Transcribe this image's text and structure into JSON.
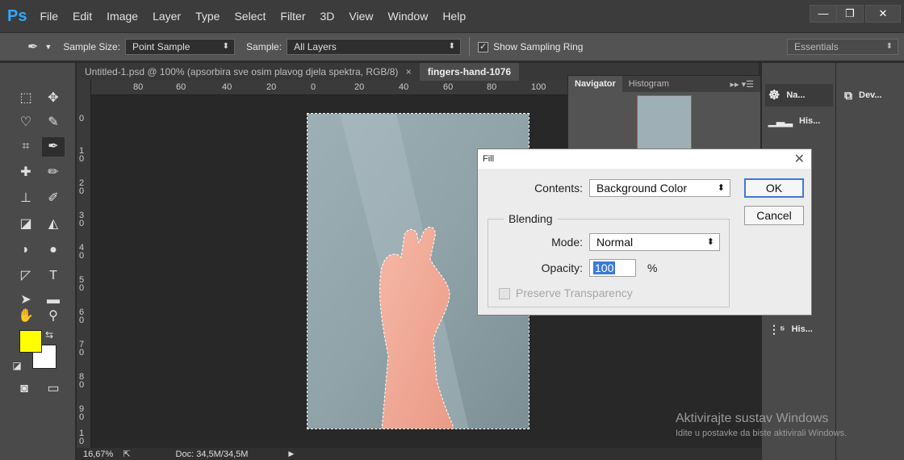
{
  "menubar": {
    "logo": "Ps",
    "items": [
      "File",
      "Edit",
      "Image",
      "Layer",
      "Type",
      "Select",
      "Filter",
      "3D",
      "View",
      "Window",
      "Help"
    ]
  },
  "options": {
    "sample_size_label": "Sample Size:",
    "sample_size_value": "Point Sample",
    "sample_label": "Sample:",
    "sample_value": "All Layers",
    "show_ring_label": "Show Sampling Ring",
    "workspace": "Essentials"
  },
  "tabs": [
    {
      "label": "Untitled-1.psd @ 100% (apsorbira sve osim  plavog djela spektra, RGB/8)",
      "close": "×"
    },
    {
      "label": "fingers-hand-1076",
      "close": "×"
    }
  ],
  "ruler": {
    "h_ticks": [
      "80",
      "60",
      "40",
      "20",
      "0",
      "20",
      "40",
      "60",
      "80",
      "100"
    ],
    "v_ticks": [
      "0",
      "1\n0",
      "2\n0",
      "3\n0",
      "4\n0",
      "5\n0",
      "6\n0",
      "7\n0",
      "8\n0",
      "9\n0",
      "1\n0"
    ]
  },
  "status": {
    "zoom": "16,67%",
    "doc": "Doc: 34,5M/34,5M"
  },
  "navigator": {
    "tab_navigator": "Navigator",
    "tab_histogram": "Histogram"
  },
  "right_panel": {
    "items": [
      {
        "label": "Na...",
        "icon": "navigator-icon"
      },
      {
        "label": "His...",
        "icon": "histogram-icon"
      },
      {
        "label": "His...",
        "icon": "history-icon"
      }
    ],
    "dev_label": "Dev..."
  },
  "fill_dialog": {
    "title": "Fill",
    "contents_label": "Contents:",
    "contents_value": "Background Color",
    "ok": "OK",
    "cancel": "Cancel",
    "blending_legend": "Blending",
    "mode_label": "Mode:",
    "mode_value": "Normal",
    "opacity_label": "Opacity:",
    "opacity_value": "100",
    "opacity_unit": "%",
    "preserve_label": "Preserve Transparency"
  },
  "watermark": {
    "line1": "Aktivirajte sustav Windows",
    "line2": "Idite u postavke da biste aktivirali Windows."
  },
  "colors": {
    "foreground": "#ffff00",
    "background": "#ffffff",
    "accent": "#31a8ff"
  }
}
